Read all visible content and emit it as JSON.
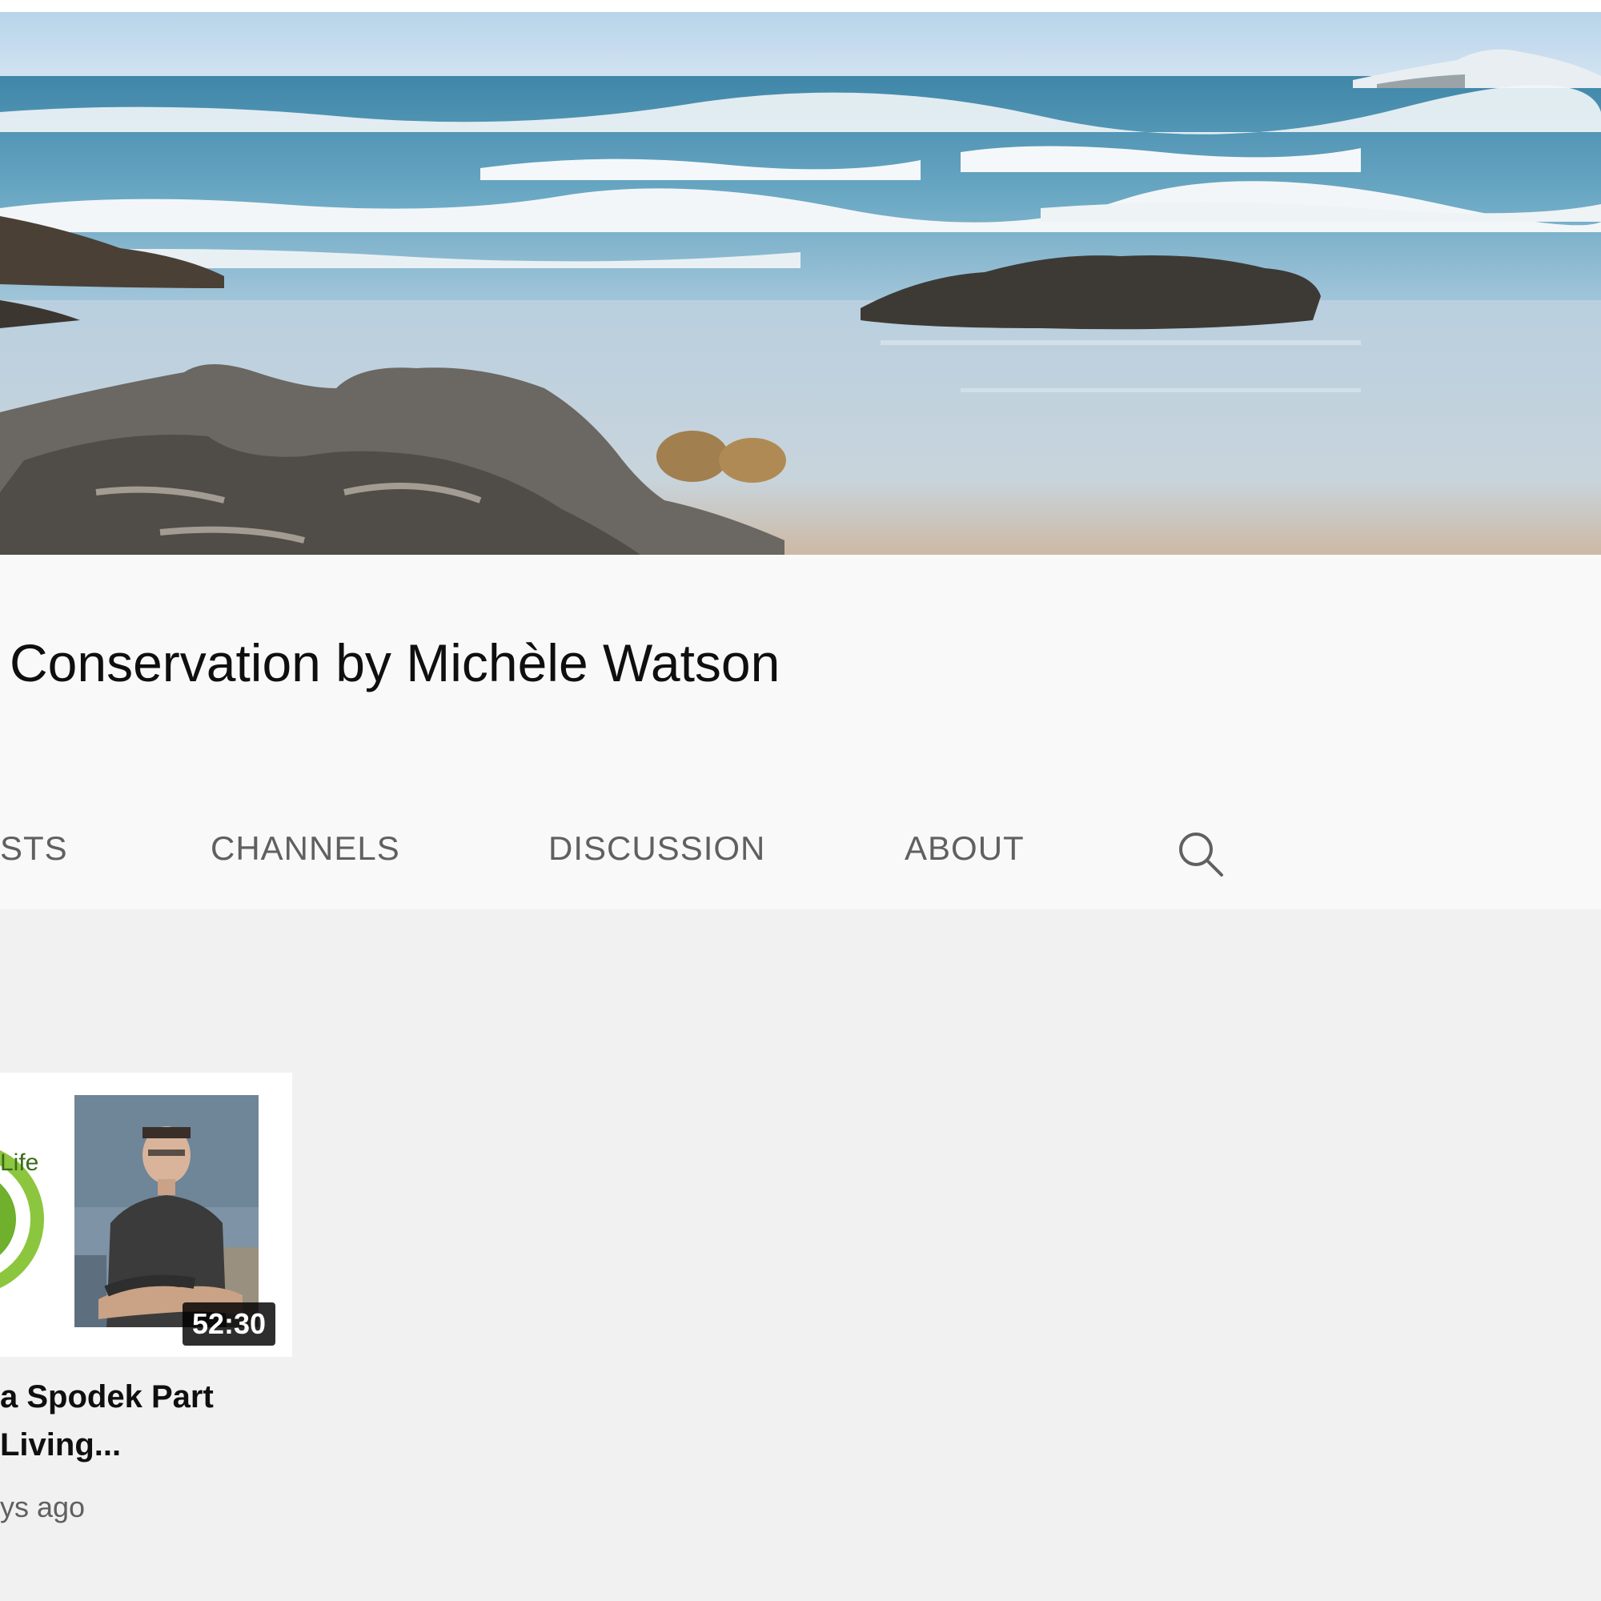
{
  "channel": {
    "title": "Conservation by Michèle Watson"
  },
  "tabs": [
    {
      "label": "STS"
    },
    {
      "label": "CHANNELS"
    },
    {
      "label": "DISCUSSION"
    },
    {
      "label": "ABOUT"
    }
  ],
  "icons": {
    "search": "search-icon"
  },
  "video": {
    "title_line1": "a Spodek Part",
    "title_line2": "Living...",
    "duration": "52:30",
    "meta": "ys ago",
    "logo_text": "Life"
  },
  "colors": {
    "header_bg": "#f9f9f9",
    "page_bg": "#f1f1f1",
    "tab_text": "#606060",
    "title_text": "#0f0f0f",
    "logo_green": "#8cc63f"
  }
}
